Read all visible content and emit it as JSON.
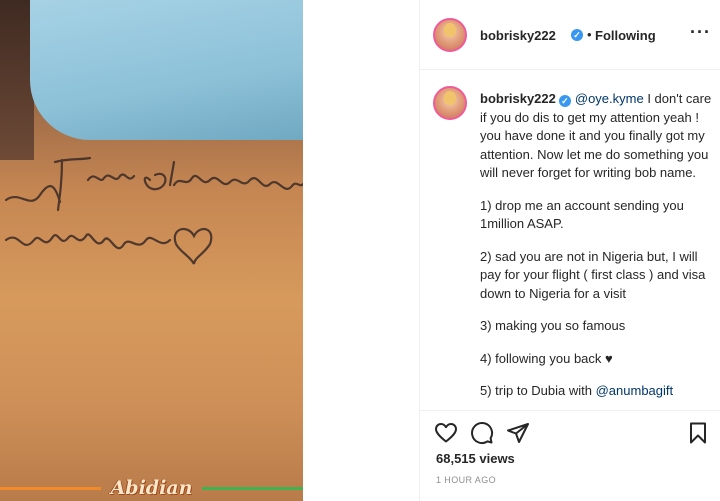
{
  "photo": {
    "location_sticker": "Abidian",
    "tattoo_lines": [
      "Idris Olanrewaju",
      "Bobrisky"
    ]
  },
  "header": {
    "username": "bobrisky222",
    "verified_mark": "✓",
    "separator": "•",
    "follow_status": "Following",
    "more_label": "···"
  },
  "caption": {
    "username": "bobrisky222",
    "mention": "@oye.kyme",
    "intro": " I don't care if you do dis to get my attention yeah ! you have done it and you finally got my attention. Now let me do something you will never forget for writing bob name.",
    "item1": "1) drop me an account sending you 1million ASAP.",
    "item2": "2) sad you are not in Nigeria but, I will pay for your flight ( first class ) and visa down to Nigeria for a visit",
    "item3": "3) making you so famous",
    "item4": "4) following you back ♥",
    "item5_prefix": "5) trip to Dubia with ",
    "item5_mention": "@anumbagift"
  },
  "actions": {
    "views": "68,515 views",
    "timestamp": "1 HOUR AGO"
  },
  "icons": [
    "heart-icon",
    "comment-icon",
    "share-icon",
    "bookmark-icon",
    "verified-badge-icon"
  ],
  "colors": {
    "link": "#00376b",
    "verified": "#3897f0",
    "meta": "#8e8e8e",
    "border": "#efefef"
  }
}
